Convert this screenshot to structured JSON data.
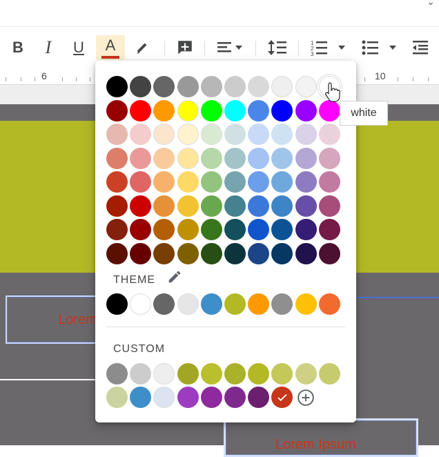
{
  "toolbar": {
    "bold": "B",
    "italic": "I",
    "underline": "U",
    "text_color": "A",
    "text_color_bar": "#c5361b"
  },
  "ruler": {
    "left_num": "6",
    "right_num": "10"
  },
  "slide": {
    "textbox1": "Lorem",
    "textbox2": "Lorem Ipsum",
    "band_color": "#b3b925",
    "bg_color": "#6b686b"
  },
  "palette": {
    "standard_colors": [
      [
        "#000000",
        "#434343",
        "#666666",
        "#999999",
        "#b7b7b7",
        "#cccccc",
        "#d9d9d9",
        "#efefef",
        "#f3f3f3",
        "#ffffff"
      ],
      [
        "#980000",
        "#ff0000",
        "#ff9900",
        "#ffff00",
        "#00ff00",
        "#00ffff",
        "#4a86e8",
        "#0000ff",
        "#9900ff",
        "#ff00ff"
      ],
      [
        "#e6b8af",
        "#f4cccc",
        "#fce5cd",
        "#fff2cc",
        "#d9ead3",
        "#d0e0e3",
        "#c9daf8",
        "#cfe2f3",
        "#d9d2e9",
        "#ead1dc"
      ],
      [
        "#dd7e6b",
        "#ea9999",
        "#f9cb9c",
        "#ffe599",
        "#b6d7a8",
        "#a2c4c9",
        "#a4c2f4",
        "#9fc5e8",
        "#b4a7d6",
        "#d5a6bd"
      ],
      [
        "#cc4125",
        "#e06666",
        "#f6b26b",
        "#ffd966",
        "#93c47d",
        "#76a5af",
        "#6d9eeb",
        "#6fa8dc",
        "#8e7cc3",
        "#c27ba0"
      ],
      [
        "#a61c00",
        "#cc0000",
        "#e69138",
        "#f1c232",
        "#6aa84f",
        "#45818e",
        "#3c78d8",
        "#3d85c6",
        "#674ea7",
        "#a64d79"
      ],
      [
        "#85200c",
        "#990000",
        "#b45f06",
        "#bf9000",
        "#38761d",
        "#134f5c",
        "#1155cc",
        "#0b5394",
        "#351c75",
        "#741b47"
      ],
      [
        "#5b0f00",
        "#660000",
        "#783f04",
        "#7f6000",
        "#274e13",
        "#0c343d",
        "#1c4587",
        "#073763",
        "#20124d",
        "#4c1130"
      ]
    ],
    "theme_label": "THEME",
    "theme_colors": [
      "#000000",
      "#ffffff",
      "#666666",
      "#e6e6e6",
      "#3d8ec9",
      "#b3b925",
      "#ff9900",
      "#8f8f8f",
      "#ffc107",
      "#f26a2e"
    ],
    "custom_label": "CUSTOM",
    "custom_colors": [
      "#8c8c8c",
      "#cccccc",
      "#eeeeee",
      "#a3a624",
      "#b9bf2d",
      "#aab12a",
      "#b3b925",
      "#c3c858",
      "#cdd184",
      "#c7cb70",
      "#cbd3a0",
      "#3d8ec9",
      "#dbe4f0",
      "#9c3cc0",
      "#8e2a9d",
      "#7e2a8d",
      "#6b1f6e"
    ],
    "selected_custom_color": "#c5361b",
    "tooltip": "white"
  }
}
